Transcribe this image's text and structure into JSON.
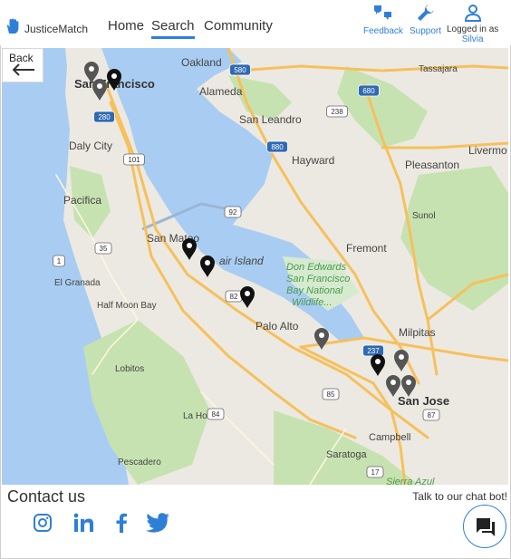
{
  "brand": {
    "name": "JusticeMatch"
  },
  "nav": {
    "home": "Home",
    "search": "Search",
    "community": "Community"
  },
  "tools": {
    "feedback": "Feedback",
    "support": "Support"
  },
  "user": {
    "status": "Logged in as",
    "name": "Silvia"
  },
  "map": {
    "back_label": "Back",
    "places": {
      "oakland": "Oakland",
      "san_francisco": "San Francisco",
      "alameda": "Alameda",
      "san_leandro": "San Leandro",
      "tassajara": "Tassajara",
      "daly_city": "Daly City",
      "hayward": "Hayward",
      "livermore": "Livermo",
      "pleasanton": "Pleasanton",
      "pacifica": "Pacifica",
      "sunol": "Sunol",
      "san_mateo": "San Mateo",
      "foster_city": "air Island",
      "fremont": "Fremont",
      "el_granada": "El Granada",
      "half_moon_bay": "Half Moon Bay",
      "palo_alto": "Palo Alto",
      "milpitas": "Milpitas",
      "lobitos": "Lobitos",
      "san_jose": "San Jose",
      "la_honda": "La Honda",
      "campbell": "Campbell",
      "pescadero": "Pescadero",
      "saratoga": "Saratoga",
      "sierra_azul": "Sierra Azul",
      "refuge": [
        "Don Edwards",
        "San Francisco",
        "Bay National",
        "Wildlife..."
      ]
    },
    "highways": [
      "580",
      "680",
      "880",
      "280",
      "101",
      "92",
      "84",
      "35",
      "1",
      "237",
      "85",
      "82",
      "17",
      "238",
      "87"
    ]
  },
  "footer": {
    "contact_title": "Contact us",
    "chat_hint": "Talk to our chat bot!"
  },
  "icons": {
    "brand": "hand-icon",
    "feedback": "thumbs-icon",
    "support": "wrench-icon",
    "user": "person-icon",
    "back": "arrow-left-icon",
    "chat": "chat-icon",
    "social": [
      "instagram-icon",
      "linkedin-icon",
      "facebook-icon",
      "twitter-icon"
    ]
  },
  "colors": {
    "accent": "#2f7fd8",
    "water": "#a9cdf2",
    "land": "#ece9e2",
    "park": "#c7e2b1",
    "highway": "#f6c05c"
  }
}
